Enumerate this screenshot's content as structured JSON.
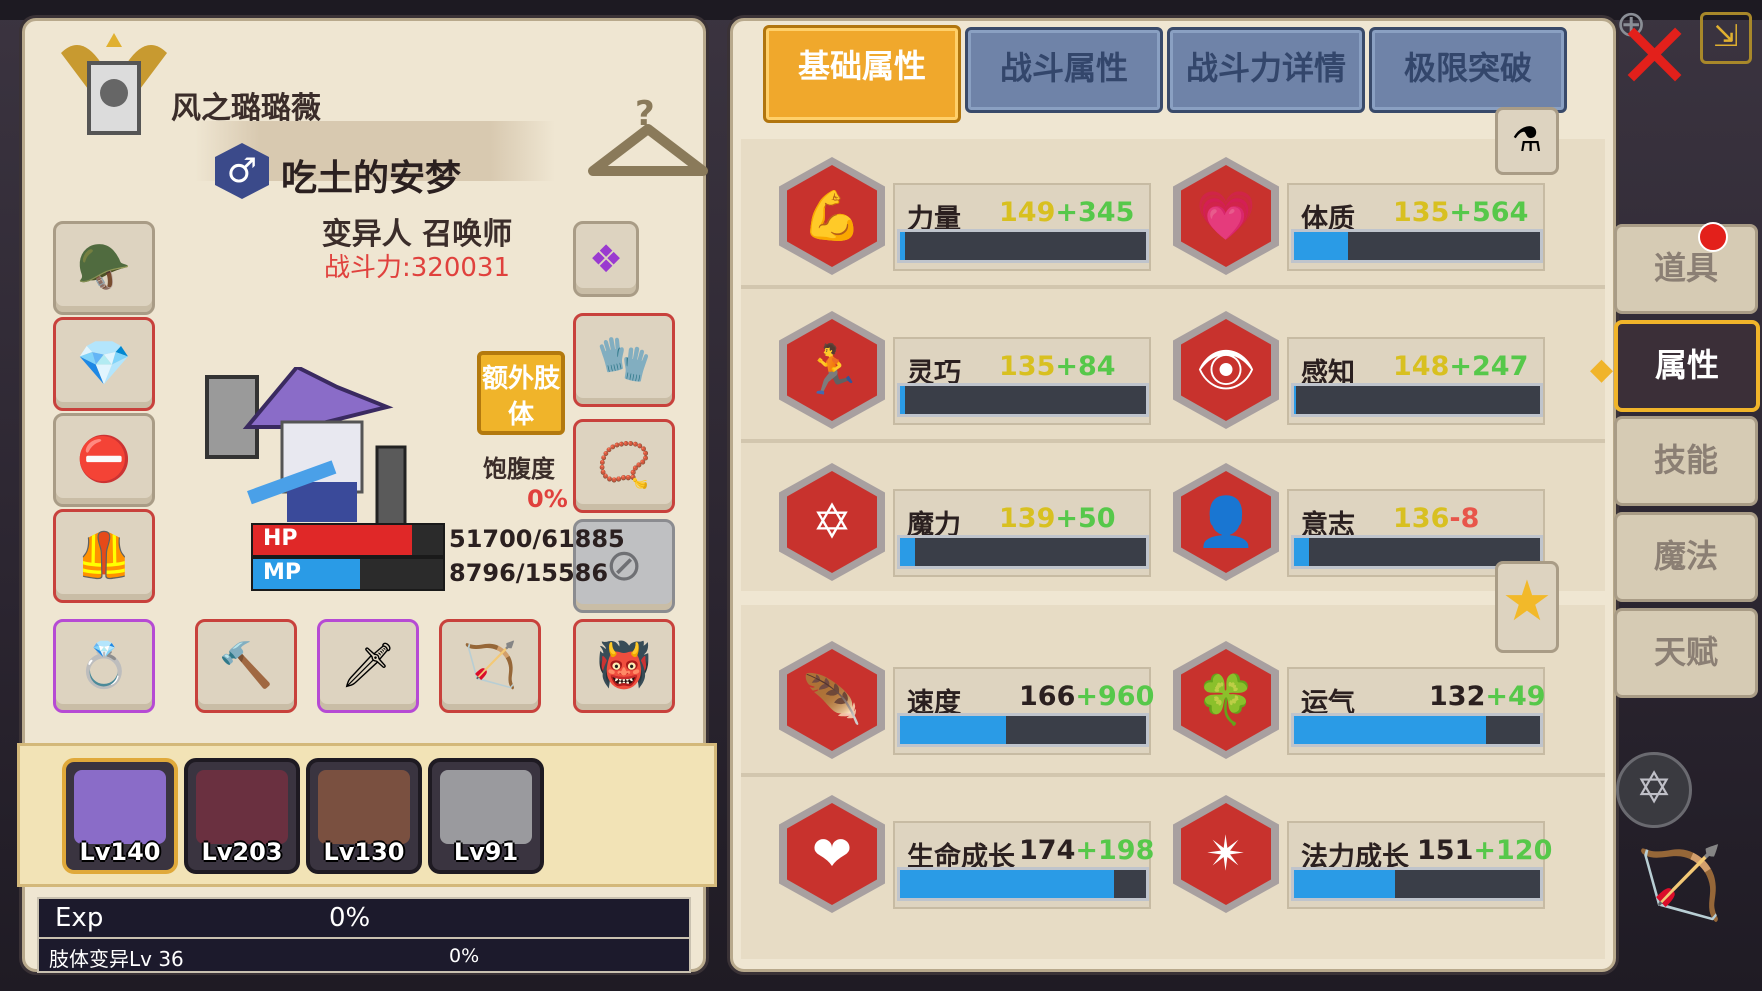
{
  "character": {
    "name": "风之璐璐薇",
    "player_name": "吃土的安梦",
    "class": "变异人 召唤师",
    "combat_power": "战斗力:320031",
    "hp": {
      "label": "HP",
      "value": "51700/61885",
      "fraction": 0.835
    },
    "mp": {
      "label": "MP",
      "value": "8796/15586",
      "fraction": 0.564
    },
    "extra_limb": "额外肢体",
    "satiety_label": "饱腹度",
    "satiety_value": "0%"
  },
  "party": [
    {
      "level": "Lv140",
      "active": true
    },
    {
      "level": "Lv203",
      "active": false
    },
    {
      "level": "Lv130",
      "active": false
    },
    {
      "level": "Lv91",
      "active": false
    }
  ],
  "exp": {
    "label": "Exp",
    "value": "0%"
  },
  "mutation": {
    "label": "肢体变异Lv 36",
    "value": "0%"
  },
  "tabs": [
    {
      "label": "基础属性",
      "active": true
    },
    {
      "label": "战斗属性",
      "active": false
    },
    {
      "label": "战斗力详情",
      "active": false
    },
    {
      "label": "极限突破",
      "active": false
    }
  ],
  "stats": [
    {
      "name": "力量",
      "base": "149",
      "bonus": "+345",
      "fill": 0.02,
      "icon": "arm-icon",
      "yellow": true
    },
    {
      "name": "体质",
      "base": "135",
      "bonus": "+564",
      "fill": 0.22,
      "icon": "muscle-icon",
      "yellow": true
    },
    {
      "name": "灵巧",
      "base": "135",
      "bonus": "+84",
      "fill": 0.02,
      "icon": "runner-icon",
      "yellow": true
    },
    {
      "name": "感知",
      "base": "148",
      "bonus": "+247",
      "fill": 0.01,
      "icon": "eye-icon",
      "yellow": true
    },
    {
      "name": "魔力",
      "base": "139",
      "bonus": "+50",
      "fill": 0.06,
      "icon": "hexagram-icon",
      "yellow": true
    },
    {
      "name": "意志",
      "base": "136",
      "bonus": "-8",
      "fill": 0.06,
      "icon": "head-icon",
      "yellow": true
    },
    {
      "name": "速度",
      "base": "166",
      "bonus": "+960",
      "fill": 0.43,
      "icon": "wing-icon",
      "yellow": false
    },
    {
      "name": "运气",
      "base": "132",
      "bonus": "+49",
      "fill": 0.78,
      "icon": "clover-icon",
      "yellow": false
    },
    {
      "name": "生命成长",
      "base": "174",
      "bonus": "+198",
      "fill": 0.87,
      "icon": "heart-icon",
      "yellow": false
    },
    {
      "name": "法力成长",
      "base": "151",
      "bonus": "+120",
      "fill": 0.41,
      "icon": "mana-star-icon",
      "yellow": false
    }
  ],
  "side_menu": [
    {
      "label": "道具",
      "active": false
    },
    {
      "label": "属性",
      "active": true
    },
    {
      "label": "技能",
      "active": false
    },
    {
      "label": "魔法",
      "active": false
    },
    {
      "label": "天赋",
      "active": false
    }
  ],
  "colors": {
    "accent": "#f0a82c",
    "stat_bar": "#2a9be6",
    "bonus": "#56c84a",
    "danger": "#e0413d"
  }
}
